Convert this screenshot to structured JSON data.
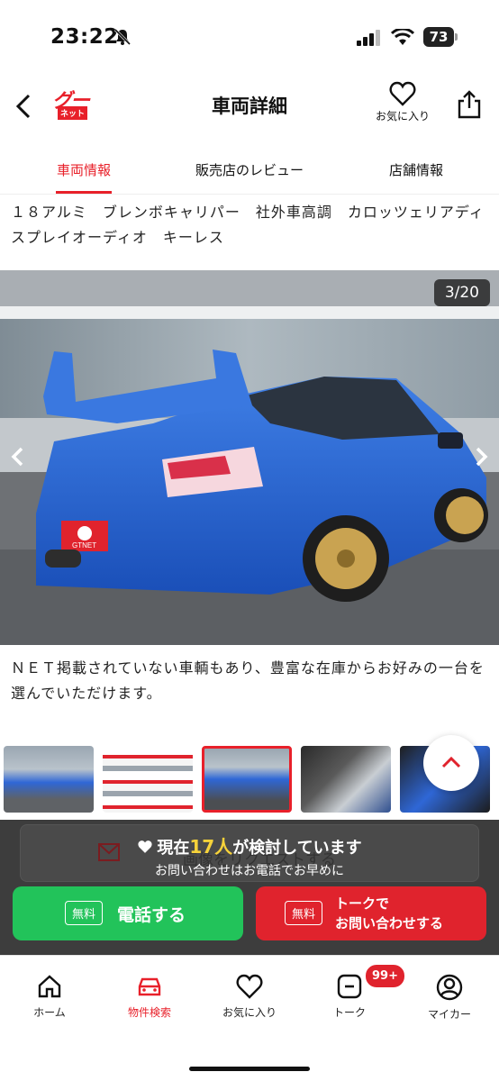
{
  "status_bar": {
    "time": "23:22",
    "battery": "73"
  },
  "header": {
    "logo_top": "グー",
    "logo_bottom": "ネット",
    "title": "車両詳細",
    "favorite_label": "お気に入り"
  },
  "tabs": [
    {
      "label": "車両情報",
      "active": true
    },
    {
      "label": "販売店のレビュー",
      "active": false
    },
    {
      "label": "店舗情報",
      "active": false
    }
  ],
  "description_top": "１８アルミ　ブレンボキャリパー　社外車高調　カロッツェリアディスプレイオーディオ　キーレス",
  "gallery": {
    "counter": "3/20",
    "plate_text": "GTNET"
  },
  "description_mid": "ＮＥＴ掲載されていない車輌もあり、豊富な在庫からお好みの一台を選んでいただけます。",
  "thumbnails": [
    "blue-car-front",
    "promo-flyer",
    "blue-car-rear",
    "interior-dashboard",
    "interior-seats"
  ],
  "cta": {
    "hidden_request_label": "画像をリクエストする",
    "interest_prefix": "現在",
    "interest_count": "17人",
    "interest_suffix": "が検討しています",
    "interest_sub": "お問い合わせはお電話でお早めに",
    "free_badge": "無料",
    "call_label": "電話する",
    "talk_line1": "トークで",
    "talk_line2": "お問い合わせする"
  },
  "bottom_nav": {
    "items": [
      {
        "label": "ホーム",
        "icon": "home-icon"
      },
      {
        "label": "物件検索",
        "icon": "car-icon",
        "active": true
      },
      {
        "label": "お気に入り",
        "icon": "heart-icon"
      },
      {
        "label": "トーク",
        "icon": "chat-icon"
      },
      {
        "label": "マイカー",
        "icon": "user-icon"
      }
    ],
    "badge": "99+"
  },
  "colors": {
    "accent": "#e8202a",
    "call_green": "#22c35a",
    "talk_red": "#e0232d"
  }
}
